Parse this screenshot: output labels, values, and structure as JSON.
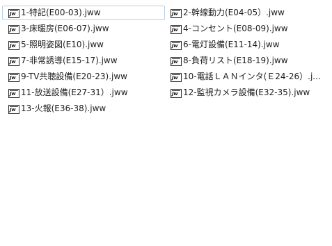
{
  "files": [
    {
      "name": "1-特記(E00-03).jww",
      "icon": "jww-file-icon",
      "icon_glyph": "Jw"
    },
    {
      "name": "2-幹線動力(E04-05）.jww",
      "icon": "jww-file-icon",
      "icon_glyph": "Jw"
    },
    {
      "name": "3-床暖房(E06-07).jww",
      "icon": "jww-file-icon",
      "icon_glyph": "Jw"
    },
    {
      "name": "4-コンセント(E08-09).jww",
      "icon": "jww-file-icon",
      "icon_glyph": "Jw"
    },
    {
      "name": "5-照明姿図(E10).jww",
      "icon": "jww-file-icon",
      "icon_glyph": "Jw"
    },
    {
      "name": "6-電灯設備(E11-14).jww",
      "icon": "jww-file-icon",
      "icon_glyph": "Jw"
    },
    {
      "name": "7-非常誘導(E15-17).jww",
      "icon": "jww-file-icon",
      "icon_glyph": "Jw"
    },
    {
      "name": "8-負荷リスト(E18-19).jww",
      "icon": "jww-file-icon",
      "icon_glyph": "Jw"
    },
    {
      "name": "9-TV共聴設備(E20-23).jww",
      "icon": "jww-file-icon",
      "icon_glyph": "Jw"
    },
    {
      "name": "10-電話ＬＡＮインタ(Ｅ24-26）.j...",
      "icon": "jww-file-icon",
      "icon_glyph": "Jw"
    },
    {
      "name": "11-放送設備(E27-31）.jww",
      "icon": "jww-file-icon",
      "icon_glyph": "Jw"
    },
    {
      "name": "12-監視カメラ設備(E32-35).jww",
      "icon": "jww-file-icon",
      "icon_glyph": "Jw"
    },
    {
      "name": "13-火報(E36-38).jww",
      "icon": "jww-file-icon",
      "icon_glyph": "Jw"
    }
  ]
}
